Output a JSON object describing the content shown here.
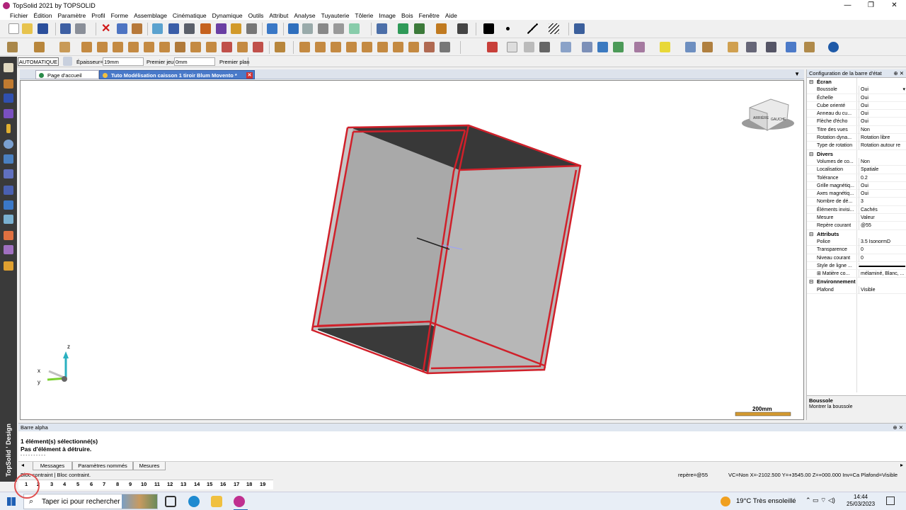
{
  "window": {
    "title": "TopSolid 2021 by TOPSOLID"
  },
  "menu": [
    "Fichier",
    "Édition",
    "Paramètre",
    "Profil",
    "Forme",
    "Assemblage",
    "Cinématique",
    "Dynamique",
    "Outils",
    "Attribut",
    "Analyse",
    "Tuyauterie",
    "Tôlerie",
    "Image",
    "Bois",
    "Fenêtre",
    "Aide"
  ],
  "params": {
    "mode": "AUTOMATIQUE",
    "thickness_label": "Épaisseur=",
    "thickness_value": "19mm",
    "gap_label": "Premier jeu=",
    "gap_value": "0mm",
    "plan_label": "Premier plan"
  },
  "tabs": [
    {
      "label": "Page d'accueil"
    },
    {
      "label": "Tuto Modélisation caisson 1 tiroir Blum Movento *"
    }
  ],
  "viewport": {
    "scale_label": "200mm",
    "axes": {
      "z": "z",
      "x": "x",
      "y": "y"
    },
    "cube_faces": [
      "ARRIÈRE",
      "GAUCHE"
    ]
  },
  "right_panel": {
    "title": "Configuration de la barre d'état",
    "groups": [
      {
        "name": "Écran",
        "rows": [
          {
            "k": "Boussole",
            "v": "Oui"
          },
          {
            "k": "Échelle",
            "v": "Oui"
          },
          {
            "k": "Cube orienté",
            "v": "Oui"
          },
          {
            "k": "Anneau du cu...",
            "v": "Oui"
          },
          {
            "k": "Flèche d'écho",
            "v": "Oui"
          },
          {
            "k": "Titre des vues",
            "v": "Non"
          },
          {
            "k": "Rotation dyna...",
            "v": "Rotation libre"
          },
          {
            "k": "Type de rotation",
            "v": "Rotation autour re"
          }
        ]
      },
      {
        "name": "Divers",
        "rows": [
          {
            "k": "Volumes de co...",
            "v": "Non"
          },
          {
            "k": "Localisation",
            "v": "Spatiale"
          },
          {
            "k": "Tolérance",
            "v": "0.2"
          },
          {
            "k": "Grille magnétiq...",
            "v": "Oui"
          },
          {
            "k": "Axes magnétiq...",
            "v": "Oui"
          },
          {
            "k": "Nombre de dé...",
            "v": "3"
          },
          {
            "k": "Éléments invisi...",
            "v": "Cachés"
          },
          {
            "k": "Mesure",
            "v": "Valeur"
          },
          {
            "k": "Repère courant",
            "v": "@55"
          }
        ]
      },
      {
        "name": "Attributs",
        "rows": [
          {
            "k": "Police",
            "v": "3.5  IsonormD"
          },
          {
            "k": "Transparence",
            "v": "0"
          },
          {
            "k": "Niveau courant",
            "v": "0"
          },
          {
            "k": "Style de ligne ...",
            "v": ""
          },
          {
            "k": "⊞ Matière co...",
            "v": "mélaminé, Blanc, ..."
          }
        ]
      },
      {
        "name": "Environnement",
        "rows": [
          {
            "k": "Plafond",
            "v": "Visible"
          }
        ]
      }
    ],
    "desc_title": "Boussole",
    "desc_text": "Montrer la boussole"
  },
  "alpha": {
    "title": "Barre alpha",
    "line1": "1 élément(s) sélectionné(s)",
    "line2": "Pas d'élément à détruire.",
    "line3": "- - - - - - - - - -",
    "tabs": [
      "Messages",
      "Paramètres nommés",
      "Mesures"
    ]
  },
  "status": {
    "left": "Bloc contraint | Bloc contraint.",
    "repere": "repère=@55",
    "coords": "VC=Non  X=-2102.500  Y=+3545.00  Z=+000.000  Inv=Ca  Plafond=Visible"
  },
  "view_numbers": [
    "1",
    "2",
    "3",
    "4",
    "5",
    "6",
    "7",
    "8",
    "9",
    "10",
    "11",
    "12",
    "13",
    "14",
    "15",
    "16",
    "17",
    "18",
    "19"
  ],
  "brand": "TopSolid ' Design",
  "taskbar": {
    "search_placeholder": "Taper ici pour rechercher",
    "weather": "19°C  Très ensoleillé",
    "time": "14:44",
    "date": "25/03/2023"
  },
  "colors": {
    "accent_tab": "#4a7ac9",
    "selection_edge": "#d0202a",
    "panel_face": "#b9b9b9",
    "dark_face": "#3c3c3c"
  }
}
